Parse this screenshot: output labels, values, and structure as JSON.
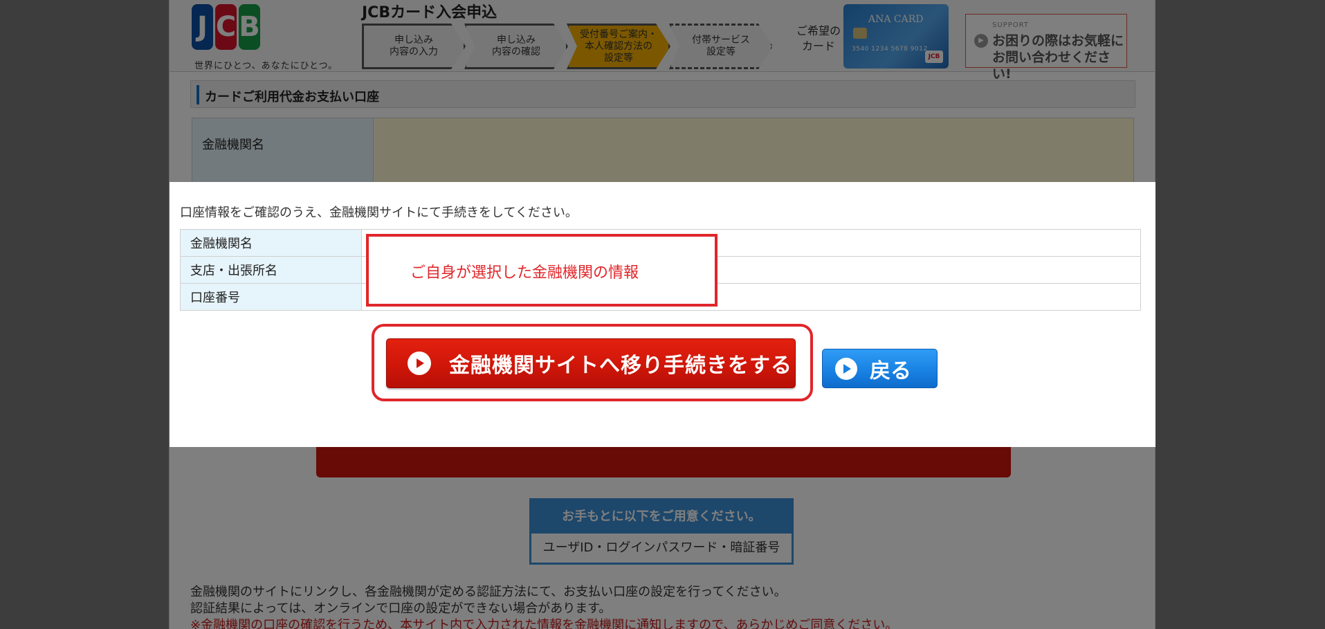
{
  "header": {
    "logo_text": "JCB",
    "tagline": "世界にひとつ、あなたにひとつ。",
    "title": "JCBカード入会申込",
    "steps": [
      {
        "line1": "申し込み",
        "line2": "内容の入力",
        "line3": ""
      },
      {
        "line1": "申し込み",
        "line2": "内容の確認",
        "line3": ""
      },
      {
        "line1": "受付番号ご案内・",
        "line2": "本人確認方法の",
        "line3": "設定等"
      },
      {
        "line1": "付帯サービス",
        "line2": "設定等",
        "line3": ""
      }
    ],
    "card_label_1": "ご希望の",
    "card_label_2": "カード",
    "card_brand": "ANA CARD",
    "card_number": "3540 1234 5678 9012",
    "support_small": "SUPPORT",
    "support_text": "お困りの際はお気軽にお問い合わせください!"
  },
  "section": {
    "title": "カードご利用代金お支払い口座",
    "row_label": "金融機関名"
  },
  "background": {
    "prepare_head": "お手もとに以下をご用意ください。",
    "prepare_body": "ユーザID・ログインパスワード・暗証番号",
    "info_line1": "金融機関のサイトにリンクし、各金融機関が定める認証方法にて、お支払い口座の設定を行ってください。",
    "info_line2": "認証結果によっては、オンラインで口座の設定ができない場合があります。",
    "info_line3": "※金融機関の口座の確認を行うため、本サイト内で入力された情報を金融機関に通知しますので、あらかじめご同意ください。"
  },
  "modal": {
    "message": "口座情報をご確認のうえ、金融機関サイトにて手続きをしてください。",
    "rows": [
      {
        "label": "金融機関名",
        "value": ""
      },
      {
        "label": "支店・出張所名",
        "value": ""
      },
      {
        "label": "口座番号",
        "value": ""
      }
    ],
    "highlight_text": "ご自身が選択した金融機関の情報",
    "proceed_label": "金融機関サイトへ移り手続きをする",
    "back_label": "戻る"
  },
  "colors": {
    "accent_red": "#e0262a",
    "button_red": "#cf1609",
    "button_blue": "#1780e2",
    "label_bg": "#e6f4fb"
  }
}
